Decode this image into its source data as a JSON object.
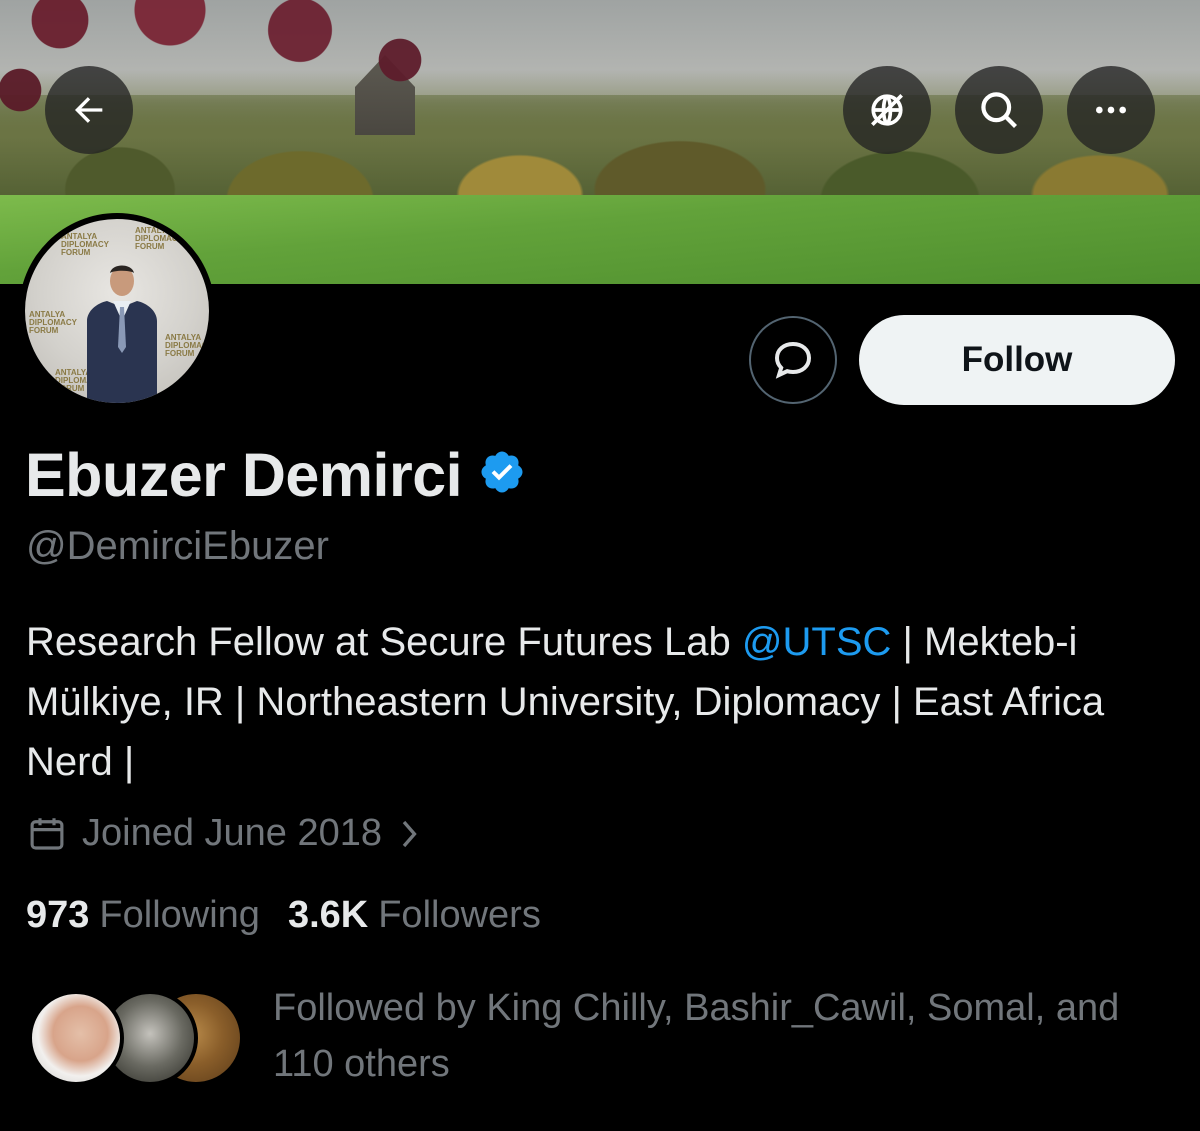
{
  "banner": {
    "back_icon": "arrow-left-icon",
    "translate_icon": "globe-slash-icon",
    "search_icon": "search-icon",
    "more_icon": "more-horizontal-icon"
  },
  "actions": {
    "message_icon": "message-icon",
    "follow_label": "Follow"
  },
  "profile": {
    "name": "Ebuzer Demirci",
    "verified_icon": "verified-badge-icon",
    "handle": "@DemirciEbuzer",
    "bio": {
      "part1": "Research Fellow at Secure Futures Lab ",
      "mention": "@UTSC",
      "part2": " | Mekteb-i Mülkiye, IR | Northeastern University, Diplomacy | East Africa Nerd |"
    },
    "joined": "Joined June 2018",
    "following_count": "973",
    "following_label": "Following",
    "followers_count": "3.6K",
    "followers_label": "Followers",
    "followed_by": "Followed by King Chilly, Bashir_Cawil, Somal, and 110 others"
  },
  "colors": {
    "background": "#000000",
    "text_primary": "#e7e9ea",
    "text_secondary": "#71767b",
    "link": "#1d9bf0",
    "follow_bg": "#eff3f4",
    "verified": "#1d9bf0"
  },
  "avatar_logo_text": "ANTALYA DIPLOMACY FORUM"
}
